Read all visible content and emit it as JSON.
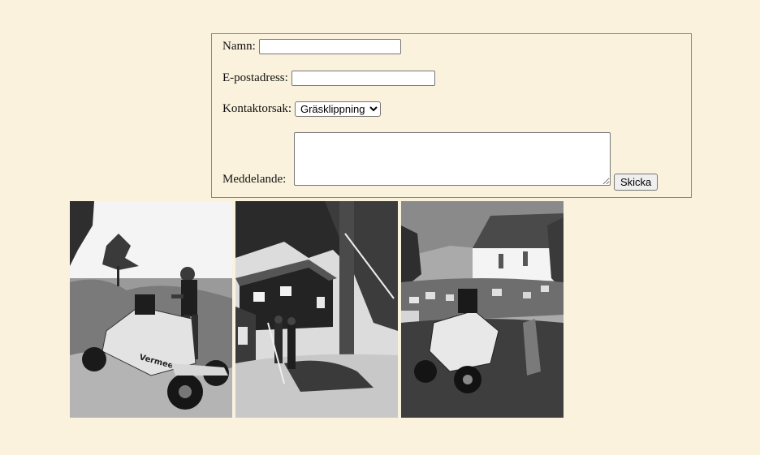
{
  "form": {
    "name_label": "Namn:",
    "name_value": "",
    "email_label": "E-postadress:",
    "email_value": "",
    "reason_label": "Kontaktorsak:",
    "reason_selected": "Gräsklippning",
    "message_label": "Meddelande:",
    "message_value": "",
    "submit_label": "Skicka"
  },
  "colors": {
    "page_background": "#faf2dd",
    "form_border": "#8c8686"
  },
  "photos": [
    {
      "name": "stump-grinder-operator-photo",
      "icon": "photo-icon"
    },
    {
      "name": "tree-felling-photo",
      "icon": "photo-icon"
    },
    {
      "name": "churchyard-stump-grinder-photo",
      "icon": "photo-icon"
    }
  ]
}
